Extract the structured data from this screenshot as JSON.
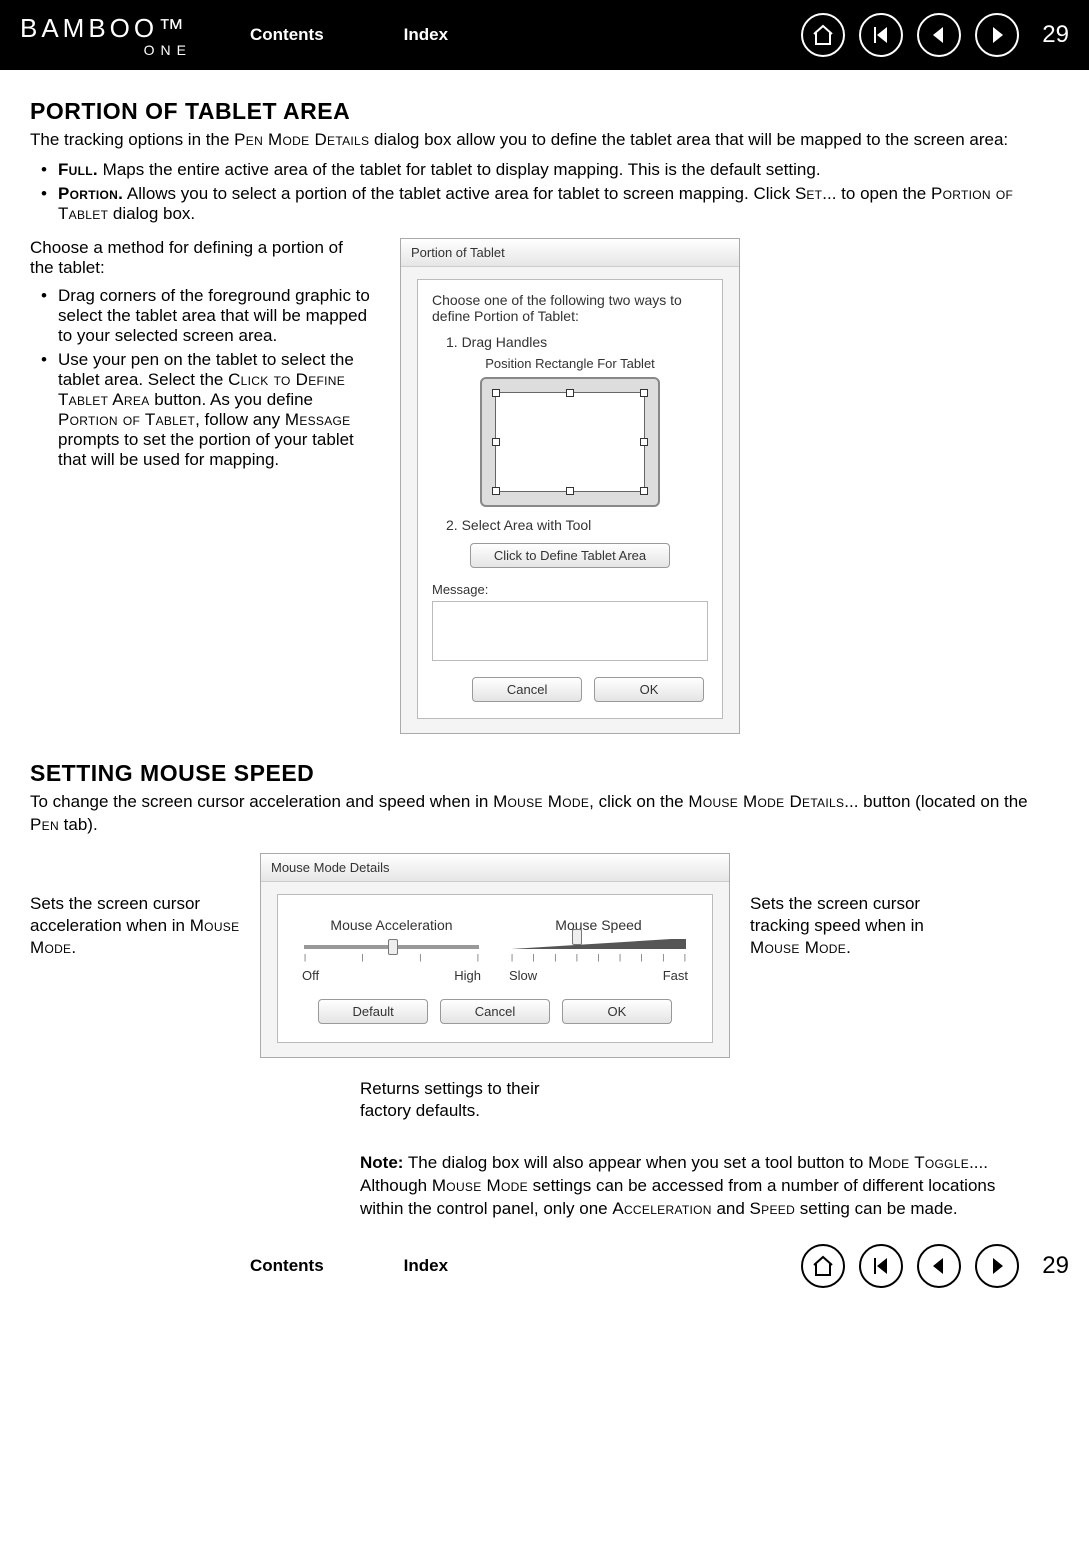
{
  "page_number": "29",
  "logo": {
    "main": "BAMBOO™",
    "sub": "ONE"
  },
  "nav": {
    "contents": "Contents",
    "index": "Index"
  },
  "section1": {
    "heading": "PORTION OF TABLET AREA",
    "intro_a": "The tracking options in the ",
    "intro_sc": "Pen Mode Details",
    "intro_b": " dialog box allow you to define the tablet area that will be mapped to the screen area:",
    "full_label": "Full.",
    "full_text": "  Maps the entire active area of the tablet for tablet to display mapping.  This is the default setting.",
    "portion_label": "Portion.",
    "portion_text_a": "  Allows you to select a portion of the tablet active area for tablet to screen mapping. Click S",
    "portion_text_set": "et",
    "portion_text_b": "... to open the ",
    "portion_text_sc": "Portion of Tablet",
    "portion_text_c": " dialog box."
  },
  "leftnotes": {
    "intro": "Choose a method for defining a portion of the tablet:",
    "b1": "Drag corners of the foreground graphic to select the tablet area that will be mapped to your selected screen area.",
    "b2_a": "Use your pen on the tablet to select the tablet area.  Select the ",
    "b2_sc1": "Click to Define Tablet Area",
    "b2_b": " button.  As you define ",
    "b2_sc2": "Portion of Tablet",
    "b2_c": ", follow any  ",
    "b2_sc3": "Message",
    "b2_d": " prompts to set the portion of your tablet that will be used for mapping."
  },
  "dialog1": {
    "title": "Portion of Tablet",
    "instruction": "Choose one of the following two ways to define Portion of Tablet:",
    "step1": "1. Drag Handles",
    "caption": "Position Rectangle For Tablet",
    "step2": "2. Select Area with Tool",
    "click_btn": "Click to Define Tablet Area",
    "message_label": "Message:",
    "cancel": "Cancel",
    "ok": "OK"
  },
  "section2": {
    "heading": "SETTING MOUSE SPEED",
    "intro_a": "To change the screen cursor acceleration and speed when in ",
    "intro_sc1": "Mouse Mode",
    "intro_b": ", click on the ",
    "intro_sc2": "Mouse Mode Details",
    "intro_c": "... button (located on the ",
    "intro_sc3": "Pen",
    "intro_d": " tab)."
  },
  "side_left_a": "Sets the screen cursor acceleration when in ",
  "side_left_sc": "Mouse Mode",
  "side_left_b": ".",
  "side_right_a": "Sets the screen cursor tracking speed when in ",
  "side_right_sc": "Mouse Mode",
  "side_right_b": ".",
  "dialog2": {
    "title": "Mouse Mode Details",
    "accel": "Mouse Acceleration",
    "speed": "Mouse Speed",
    "off": "Off",
    "high": "High",
    "slow": "Slow",
    "fast": "Fast",
    "default": "Default",
    "cancel": "Cancel",
    "ok": "OK"
  },
  "underlabel": "Returns settings to their factory defaults.",
  "note_label": "Note:",
  "note_a": " The dialog box will also appear when you set a tool button to ",
  "note_sc1": "Mode Toggle",
  "note_b": "....  Although ",
  "note_sc2": "Mouse Mode",
  "note_c": " settings can be accessed from a number of different locations within the control panel, only one ",
  "note_sc3": "Acceleration",
  "note_d": " and ",
  "note_sc4": "Speed",
  "note_e": " setting can be made."
}
